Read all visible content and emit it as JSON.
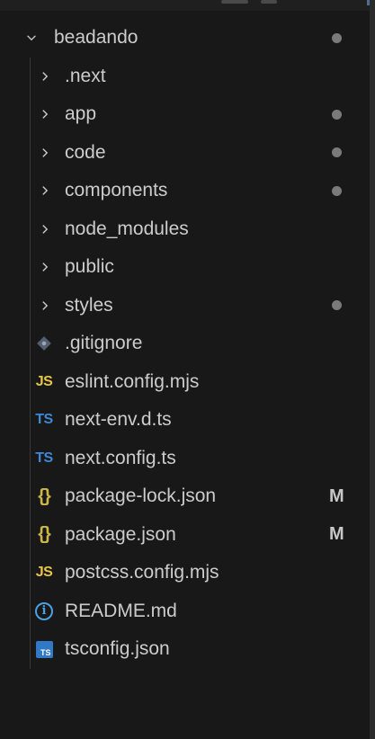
{
  "explorer": {
    "root": {
      "name": "beadando",
      "expanded": true,
      "decoration": "modified-dot"
    },
    "items": [
      {
        "kind": "folder",
        "name": ".next",
        "decoration": "none",
        "icon": "chevron-right-icon"
      },
      {
        "kind": "folder",
        "name": "app",
        "decoration": "modified-dot",
        "icon": "chevron-right-icon"
      },
      {
        "kind": "folder",
        "name": "code",
        "decoration": "modified-dot",
        "icon": "chevron-right-icon"
      },
      {
        "kind": "folder",
        "name": "components",
        "decoration": "modified-dot",
        "icon": "chevron-right-icon"
      },
      {
        "kind": "folder",
        "name": "node_modules",
        "decoration": "none",
        "icon": "chevron-right-icon"
      },
      {
        "kind": "folder",
        "name": "public",
        "decoration": "none",
        "icon": "chevron-right-icon"
      },
      {
        "kind": "folder",
        "name": "styles",
        "decoration": "modified-dot",
        "icon": "chevron-right-icon"
      },
      {
        "kind": "file",
        "name": ".gitignore",
        "icon": "git-icon",
        "decoration": "none"
      },
      {
        "kind": "file",
        "name": "eslint.config.mjs",
        "icon": "javascript-icon",
        "icon_text": "JS",
        "decoration": "none"
      },
      {
        "kind": "file",
        "name": "next-env.d.ts",
        "icon": "typescript-icon",
        "icon_text": "TS",
        "decoration": "none"
      },
      {
        "kind": "file",
        "name": "next.config.ts",
        "icon": "typescript-icon",
        "icon_text": "TS",
        "decoration": "none"
      },
      {
        "kind": "file",
        "name": "package-lock.json",
        "icon": "json-icon",
        "icon_text": "{}",
        "decoration": "M"
      },
      {
        "kind": "file",
        "name": "package.json",
        "icon": "json-icon",
        "icon_text": "{}",
        "decoration": "M"
      },
      {
        "kind": "file",
        "name": "postcss.config.mjs",
        "icon": "javascript-icon",
        "icon_text": "JS",
        "decoration": "none"
      },
      {
        "kind": "file",
        "name": "README.md",
        "icon": "info-icon",
        "icon_text": "i",
        "decoration": "none"
      },
      {
        "kind": "file",
        "name": "tsconfig.json",
        "icon": "tsconfig-icon",
        "icon_text": "TS",
        "decoration": "none"
      }
    ]
  },
  "colors": {
    "background": "#181818",
    "text": "#cccccc",
    "javascript": "#e8c547",
    "typescript": "#3f88d6",
    "json": "#cbb648",
    "info": "#4aa1e0",
    "git": "#6b7a8c",
    "dot": "#7a7a7a"
  }
}
